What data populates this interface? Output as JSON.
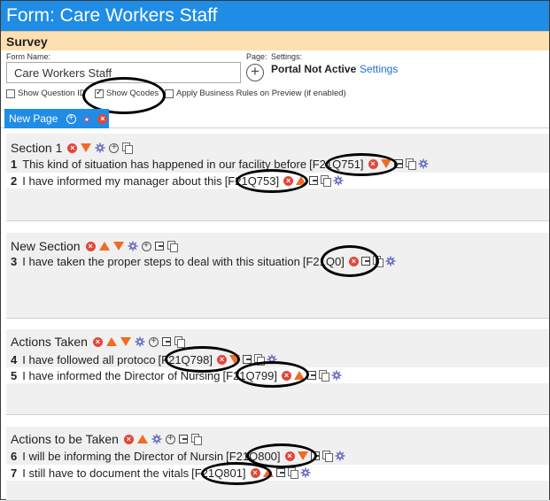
{
  "window": {
    "title": "Form: Care Workers Staff"
  },
  "survey_bar": {
    "label": "Survey"
  },
  "form": {
    "name_label": "Form Name:",
    "name_value": "Care Workers Staff",
    "page_label": "Page:",
    "settings_label": "Settings:",
    "portal_status": "Portal Not Active",
    "settings_link": "Settings"
  },
  "options": {
    "show_question": "Show Question ID",
    "show_qcodes": "Show Qcodes",
    "apply_rules": "Apply Business Rules on Preview (if enabled)"
  },
  "tab": {
    "label": "New Page"
  },
  "sections": [
    {
      "title": "Section 1",
      "questions": [
        {
          "num": "1",
          "text": "This kind of situation has happened in our facility before",
          "code": "[F21Q751]"
        },
        {
          "num": "2",
          "text": "I have informed my manager about this",
          "code": "[F21Q753]"
        }
      ]
    },
    {
      "title": "New Section",
      "questions": [
        {
          "num": "3",
          "text": "I have taken the proper steps to deal with this situation",
          "code": "[F21Q0]"
        }
      ]
    },
    {
      "title": "Actions Taken",
      "questions": [
        {
          "num": "4",
          "text": "I have followed all protoco",
          "code": "[F21Q798]"
        },
        {
          "num": "5",
          "text": "I have informed the Director of Nursing",
          "code": "[F21Q799]"
        }
      ]
    },
    {
      "title": "Actions to be Taken",
      "questions": [
        {
          "num": "6",
          "text": "I will be informing the Director of Nursin",
          "code": "[F21Q800]"
        },
        {
          "num": "7",
          "text": "I still have to document the vitals",
          "code": "[F21Q801]"
        }
      ]
    }
  ],
  "colors": {
    "accent": "#1f8ce6",
    "survey_bar": "#fde0b0",
    "delete": "#e2473a",
    "arrow": "#f06b23"
  },
  "icons": [
    "delete-icon",
    "move-down-icon",
    "move-up-icon",
    "gear-icon",
    "add-icon",
    "export-icon",
    "copy-icon"
  ]
}
